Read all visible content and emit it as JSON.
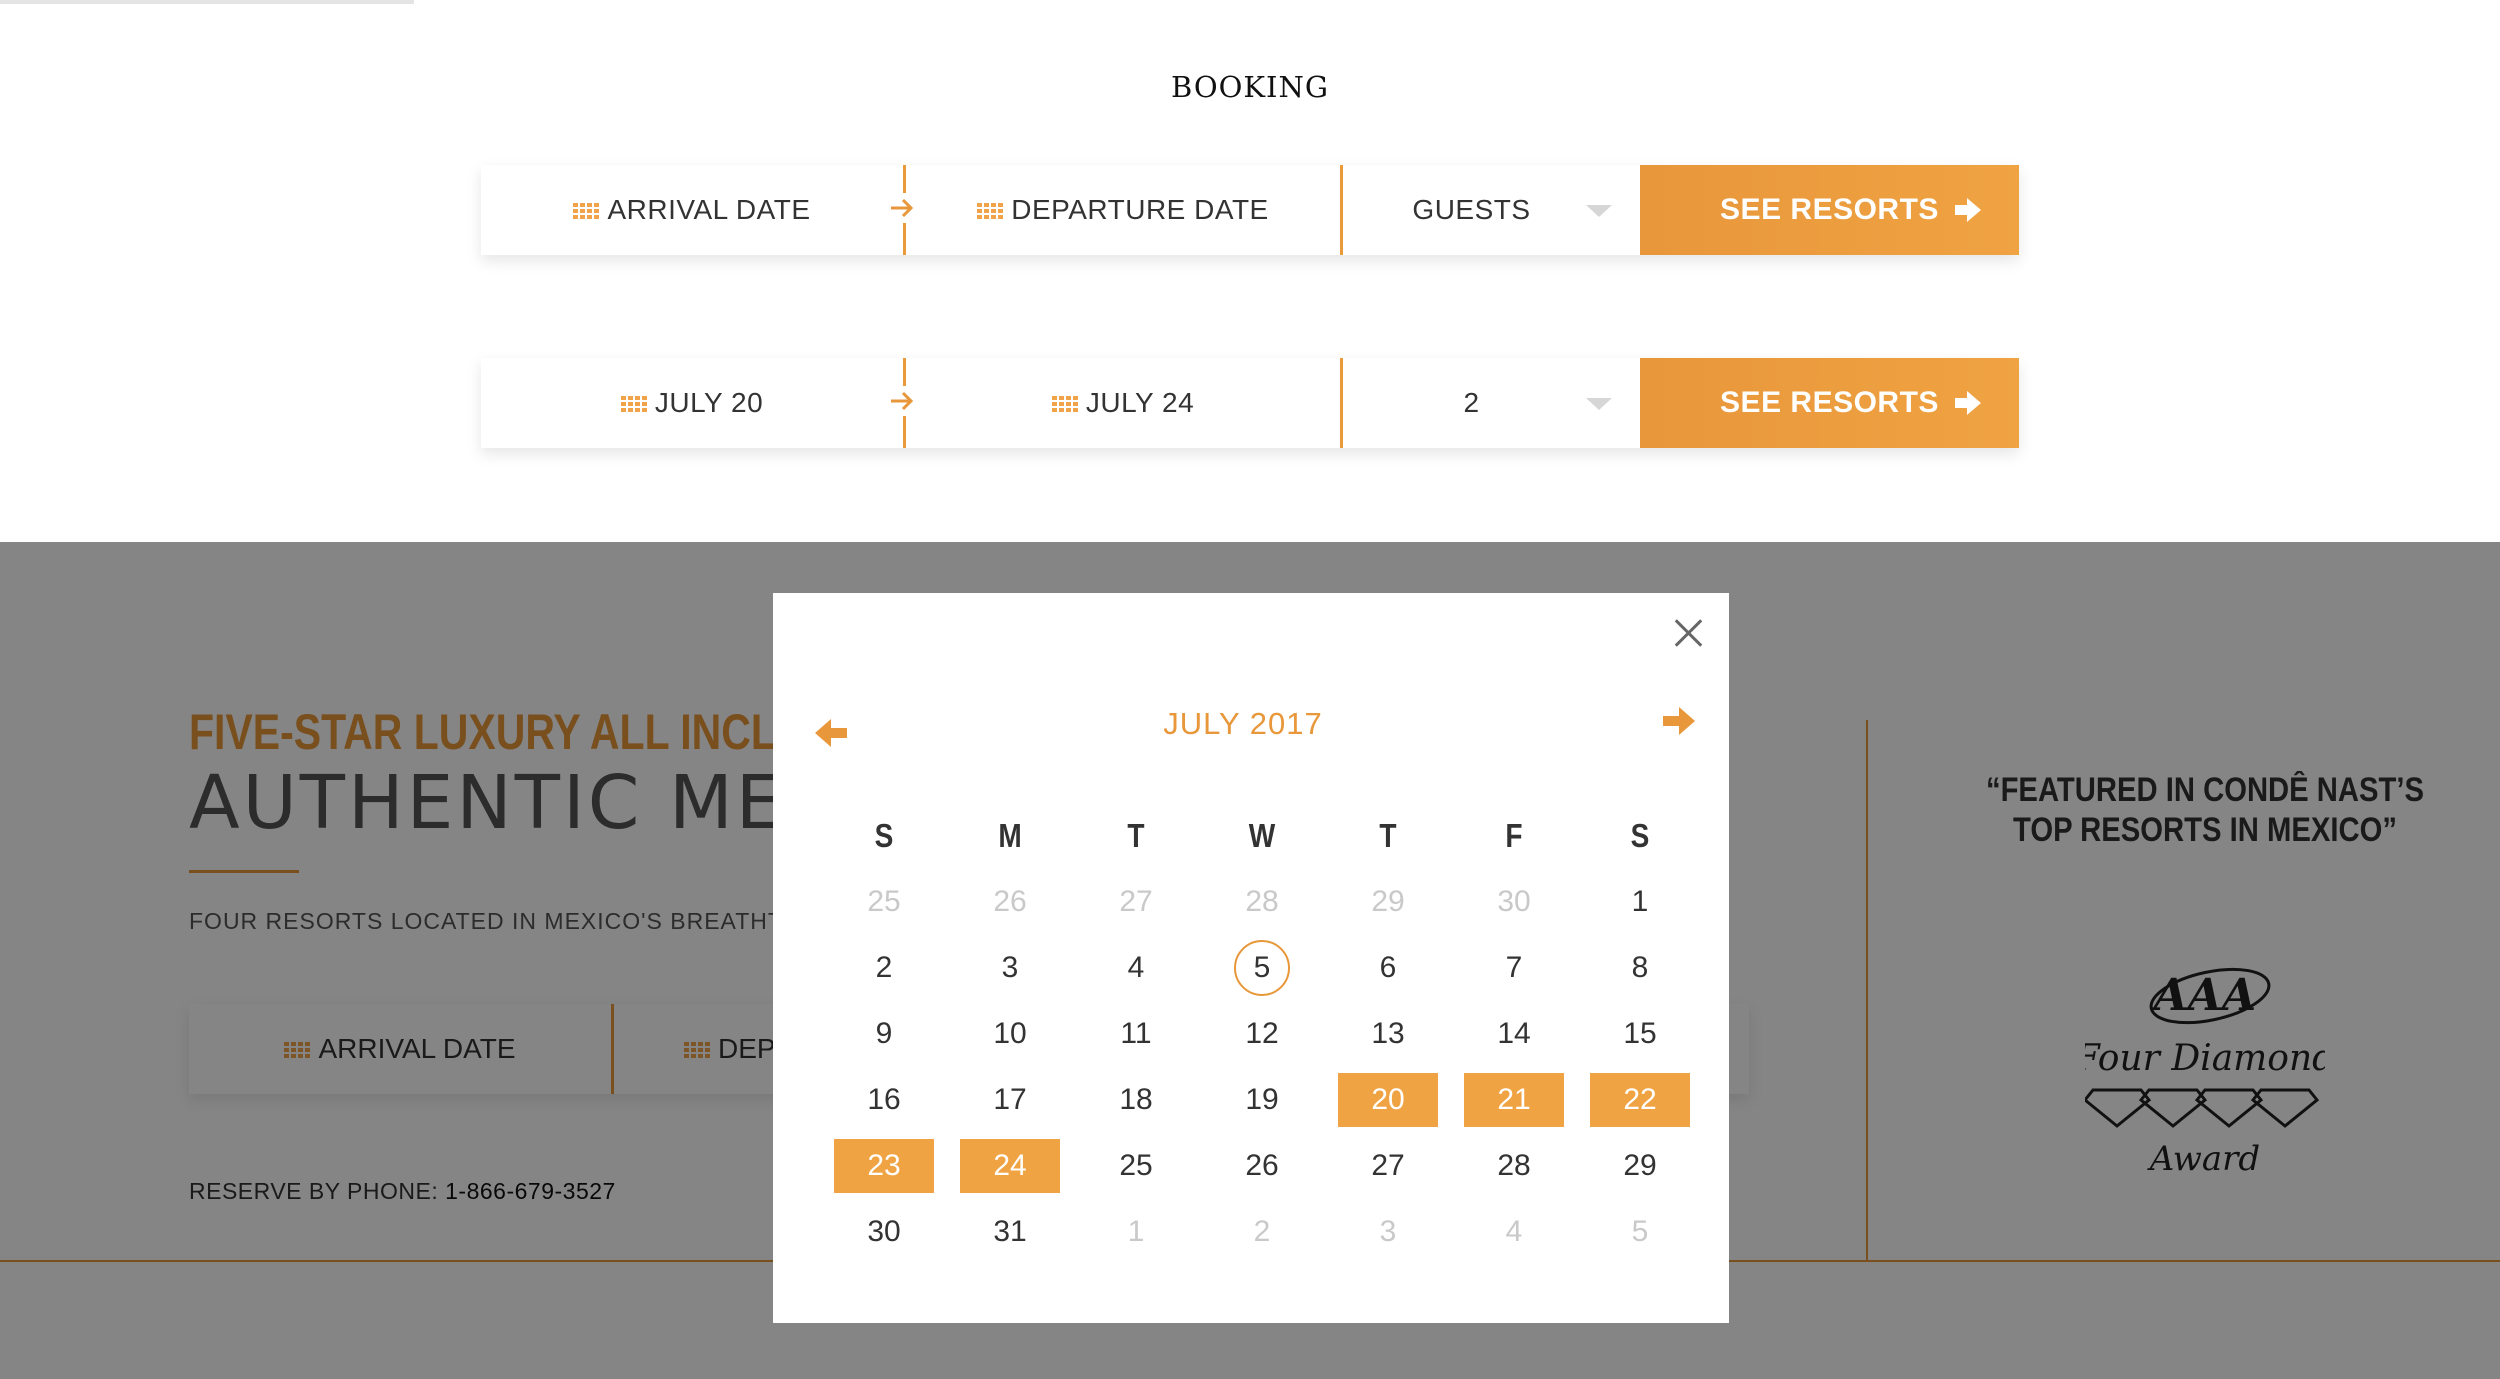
{
  "booking": {
    "title": "BOOKING",
    "bar1": {
      "arrival": "ARRIVAL DATE",
      "departure": "DEPARTURE DATE",
      "guests": "GUESTS",
      "button": "SEE RESORTS"
    },
    "bar2": {
      "arrival": "JULY 20",
      "departure": "JULY 24",
      "guests": "2",
      "button": "SEE RESORTS"
    }
  },
  "hero": {
    "headline": "FIVE-STAR LUXURY ALL INCLUS",
    "subheadline": "AUTHENTIC MEXIC",
    "tagline": "FOUR RESORTS LOCATED IN MEXICO'S BREATHTAK",
    "arrival": "ARRIVAL DATE",
    "departure": "DEP",
    "phone_label": "RESERVE BY PHONE: ",
    "phone_number": "1-866-679-3527"
  },
  "featured": {
    "quote_line1": "“FEATURED IN CONDÊ NAST’S",
    "quote_line2": "TOP RESORTS IN MEXICO”",
    "award_top": "AAA",
    "award_mid": "Four Diamond",
    "award_bottom": "Award"
  },
  "calendar": {
    "month": "JULY 2017",
    "weekdays": [
      "S",
      "M",
      "T",
      "W",
      "T",
      "F",
      "S"
    ],
    "weeks": [
      [
        {
          "d": "25",
          "o": true
        },
        {
          "d": "26",
          "o": true
        },
        {
          "d": "27",
          "o": true
        },
        {
          "d": "28",
          "o": true
        },
        {
          "d": "29",
          "o": true
        },
        {
          "d": "30",
          "o": true
        },
        {
          "d": "1"
        }
      ],
      [
        {
          "d": "2"
        },
        {
          "d": "3"
        },
        {
          "d": "4"
        },
        {
          "d": "5",
          "today": true
        },
        {
          "d": "6"
        },
        {
          "d": "7"
        },
        {
          "d": "8"
        }
      ],
      [
        {
          "d": "9"
        },
        {
          "d": "10"
        },
        {
          "d": "11"
        },
        {
          "d": "12"
        },
        {
          "d": "13"
        },
        {
          "d": "14"
        },
        {
          "d": "15"
        }
      ],
      [
        {
          "d": "16"
        },
        {
          "d": "17"
        },
        {
          "d": "18"
        },
        {
          "d": "19"
        },
        {
          "d": "20",
          "sel": true
        },
        {
          "d": "21",
          "sel": true
        },
        {
          "d": "22",
          "sel": true
        }
      ],
      [
        {
          "d": "23",
          "sel": true
        },
        {
          "d": "24",
          "sel": true
        },
        {
          "d": "25"
        },
        {
          "d": "26"
        },
        {
          "d": "27"
        },
        {
          "d": "28"
        },
        {
          "d": "29"
        }
      ],
      [
        {
          "d": "30"
        },
        {
          "d": "31"
        },
        {
          "d": "1",
          "o": true
        },
        {
          "d": "2",
          "o": true
        },
        {
          "d": "3",
          "o": true
        },
        {
          "d": "4",
          "o": true
        },
        {
          "d": "5",
          "o": true
        }
      ]
    ]
  },
  "colors": {
    "accent": "#e8973a",
    "overlay": "rgba(0,0,0,0.48)"
  }
}
